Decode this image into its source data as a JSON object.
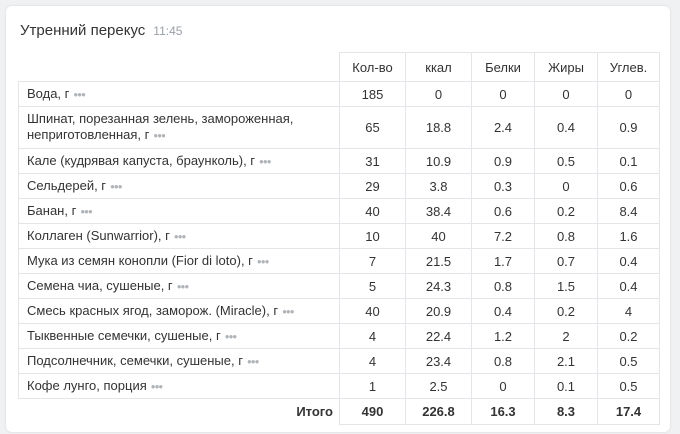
{
  "meal": {
    "title": "Утренний перекус",
    "time": "11:45"
  },
  "table": {
    "columns": [
      "Кол-во",
      "ккал",
      "Белки",
      "Жиры",
      "Углев."
    ],
    "rows": [
      {
        "name": "Вода, г",
        "qty": "185",
        "kcal": "0",
        "protein": "0",
        "fat": "0",
        "carbs": "0"
      },
      {
        "name": "Шпинат, порезанная зелень, замороженная, неприготовленная, г",
        "qty": "65",
        "kcal": "18.8",
        "protein": "2.4",
        "fat": "0.4",
        "carbs": "0.9"
      },
      {
        "name": "Кале (кудрявая капуста, браунколь), г",
        "qty": "31",
        "kcal": "10.9",
        "protein": "0.9",
        "fat": "0.5",
        "carbs": "0.1"
      },
      {
        "name": "Сельдерей, г",
        "qty": "29",
        "kcal": "3.8",
        "protein": "0.3",
        "fat": "0",
        "carbs": "0.6"
      },
      {
        "name": "Банан, г",
        "qty": "40",
        "kcal": "38.4",
        "protein": "0.6",
        "fat": "0.2",
        "carbs": "8.4"
      },
      {
        "name": "Коллаген (Sunwarrior), г",
        "qty": "10",
        "kcal": "40",
        "protein": "7.2",
        "fat": "0.8",
        "carbs": "1.6"
      },
      {
        "name": "Мука из семян конопли (Fior di loto), г",
        "qty": "7",
        "kcal": "21.5",
        "protein": "1.7",
        "fat": "0.7",
        "carbs": "0.4"
      },
      {
        "name": "Семена чиа, сушеные, г",
        "qty": "5",
        "kcal": "24.3",
        "protein": "0.8",
        "fat": "1.5",
        "carbs": "0.4"
      },
      {
        "name": "Смесь красных ягод, заморож. (Miracle), г",
        "qty": "40",
        "kcal": "20.9",
        "protein": "0.4",
        "fat": "0.2",
        "carbs": "4"
      },
      {
        "name": "Тыквенные семечки, сушеные, г",
        "qty": "4",
        "kcal": "22.4",
        "protein": "1.2",
        "fat": "2",
        "carbs": "0.2"
      },
      {
        "name": "Подсолнечник, семечки, сушеные, г",
        "qty": "4",
        "kcal": "23.4",
        "protein": "0.8",
        "fat": "2.1",
        "carbs": "0.5"
      },
      {
        "name": "Кофе лунго, порция",
        "qty": "1",
        "kcal": "2.5",
        "protein": "0",
        "fat": "0.1",
        "carbs": "0.5"
      }
    ],
    "total": {
      "label": "Итого",
      "qty": "490",
      "kcal": "226.8",
      "protein": "16.3",
      "fat": "8.3",
      "carbs": "17.4"
    }
  },
  "icons": {
    "row_menu": "more-dots-icon",
    "row_menu_glyph": "●●●"
  },
  "colors": {
    "border": "#e3e5e8",
    "text": "#333333",
    "muted": "#9aa0a6",
    "page_bg": "#f0f1f2"
  }
}
